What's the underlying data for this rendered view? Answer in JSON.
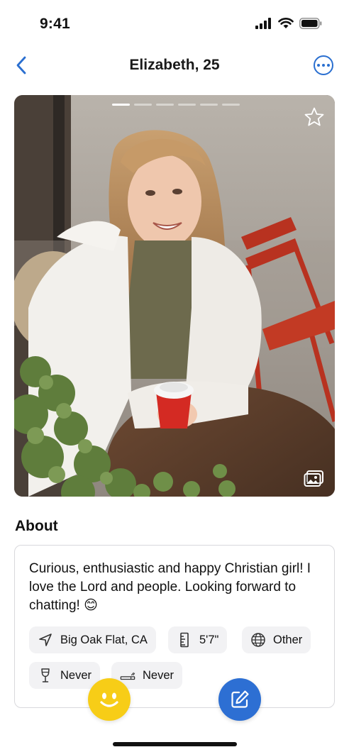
{
  "status_bar": {
    "time": "9:41"
  },
  "nav": {
    "title": "Elizabeth, 25"
  },
  "photo": {
    "page_count": 6,
    "active_page": 1
  },
  "about": {
    "heading": "About",
    "bio": "Curious, enthusiastic and happy Christian girl! I love the Lord and people. Looking forward to chatting! 😊",
    "chips": [
      {
        "icon": "location-icon",
        "label": "Big Oak Flat, CA"
      },
      {
        "icon": "ruler-icon",
        "label": "5'7\""
      },
      {
        "icon": "globe-icon",
        "label": "Other"
      },
      {
        "icon": "wine-glass-icon",
        "label": "Never"
      },
      {
        "icon": "cigarette-icon",
        "label": "Never"
      }
    ]
  },
  "colors": {
    "accent": "#2a6fd0",
    "smile_button": "#f7cd17",
    "chip_bg": "#f2f2f4"
  }
}
